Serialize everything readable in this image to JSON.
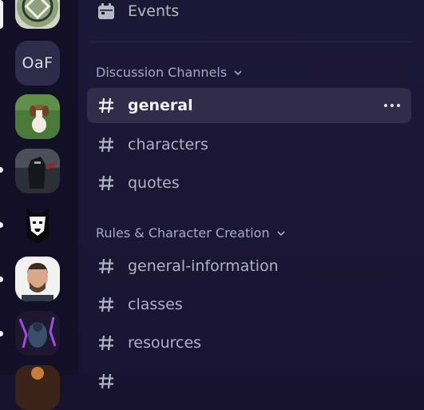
{
  "server_rail": {
    "servers": [
      {
        "name": "server-partial-top",
        "initials": ""
      },
      {
        "name": "server-oaf",
        "initials": "OaF"
      },
      {
        "name": "server-dog",
        "initials": ""
      },
      {
        "name": "server-knight",
        "initials": ""
      },
      {
        "name": "server-mask",
        "initials": ""
      },
      {
        "name": "server-man",
        "initials": ""
      },
      {
        "name": "server-warrior",
        "initials": ""
      },
      {
        "name": "server-partial-bottom",
        "initials": ""
      }
    ]
  },
  "channel_list": {
    "events_label": "Events",
    "categories": [
      {
        "label": "Discussion Channels",
        "channels": [
          {
            "label": "general",
            "active": true
          },
          {
            "label": "characters"
          },
          {
            "label": "quotes"
          }
        ]
      },
      {
        "label": "Rules & Character Creation",
        "channels": [
          {
            "label": "general-information"
          },
          {
            "label": "classes"
          },
          {
            "label": "resources"
          }
        ]
      }
    ]
  },
  "colors": {
    "rail_bg": "#120f26",
    "list_bg": "#1b1736",
    "active_bg": "#302c4a",
    "text_muted": "#aeb2c4",
    "text_active": "#f2f3f5"
  }
}
